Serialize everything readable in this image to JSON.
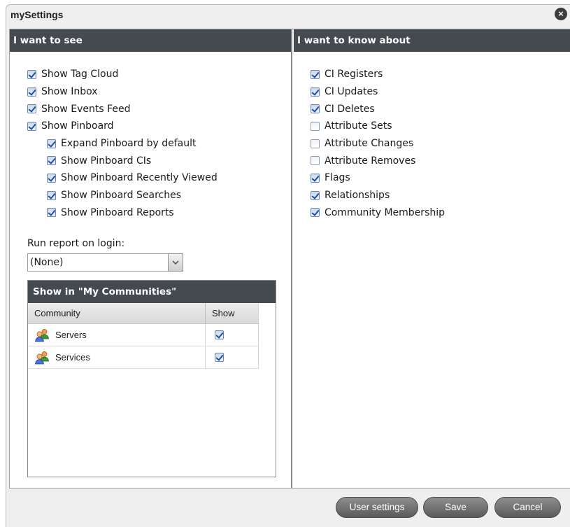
{
  "dialog": {
    "title": "mySettings",
    "close_icon": "close-icon"
  },
  "left": {
    "header": "I want to see",
    "options": [
      {
        "label": "Show Tag Cloud",
        "checked": true,
        "indent": false
      },
      {
        "label": "Show Inbox",
        "checked": true,
        "indent": false
      },
      {
        "label": "Show Events Feed",
        "checked": true,
        "indent": false
      },
      {
        "label": "Show Pinboard",
        "checked": true,
        "indent": false
      },
      {
        "label": "Expand Pinboard by default",
        "checked": true,
        "indent": true
      },
      {
        "label": "Show Pinboard CIs",
        "checked": true,
        "indent": true
      },
      {
        "label": "Show Pinboard Recently Viewed",
        "checked": true,
        "indent": true
      },
      {
        "label": "Show Pinboard Searches",
        "checked": true,
        "indent": true
      },
      {
        "label": "Show Pinboard Reports",
        "checked": true,
        "indent": true
      }
    ],
    "run_report_label": "Run report on login:",
    "run_report_value": "(None)",
    "communities": {
      "title": "Show in \"My Communities\"",
      "col_community": "Community",
      "col_show": "Show",
      "rows": [
        {
          "name": "Servers",
          "show": true
        },
        {
          "name": "Services",
          "show": true
        }
      ]
    }
  },
  "right": {
    "header": "I want to know about",
    "options": [
      {
        "label": "CI Registers",
        "checked": true
      },
      {
        "label": "CI Updates",
        "checked": true
      },
      {
        "label": "CI Deletes",
        "checked": true
      },
      {
        "label": "Attribute Sets",
        "checked": false
      },
      {
        "label": "Attribute Changes",
        "checked": false
      },
      {
        "label": "Attribute Removes",
        "checked": false
      },
      {
        "label": "Flags",
        "checked": true
      },
      {
        "label": "Relationships",
        "checked": true
      },
      {
        "label": "Community Membership",
        "checked": true
      }
    ]
  },
  "footer": {
    "user_settings": "User settings",
    "save": "Save",
    "cancel": "Cancel"
  }
}
